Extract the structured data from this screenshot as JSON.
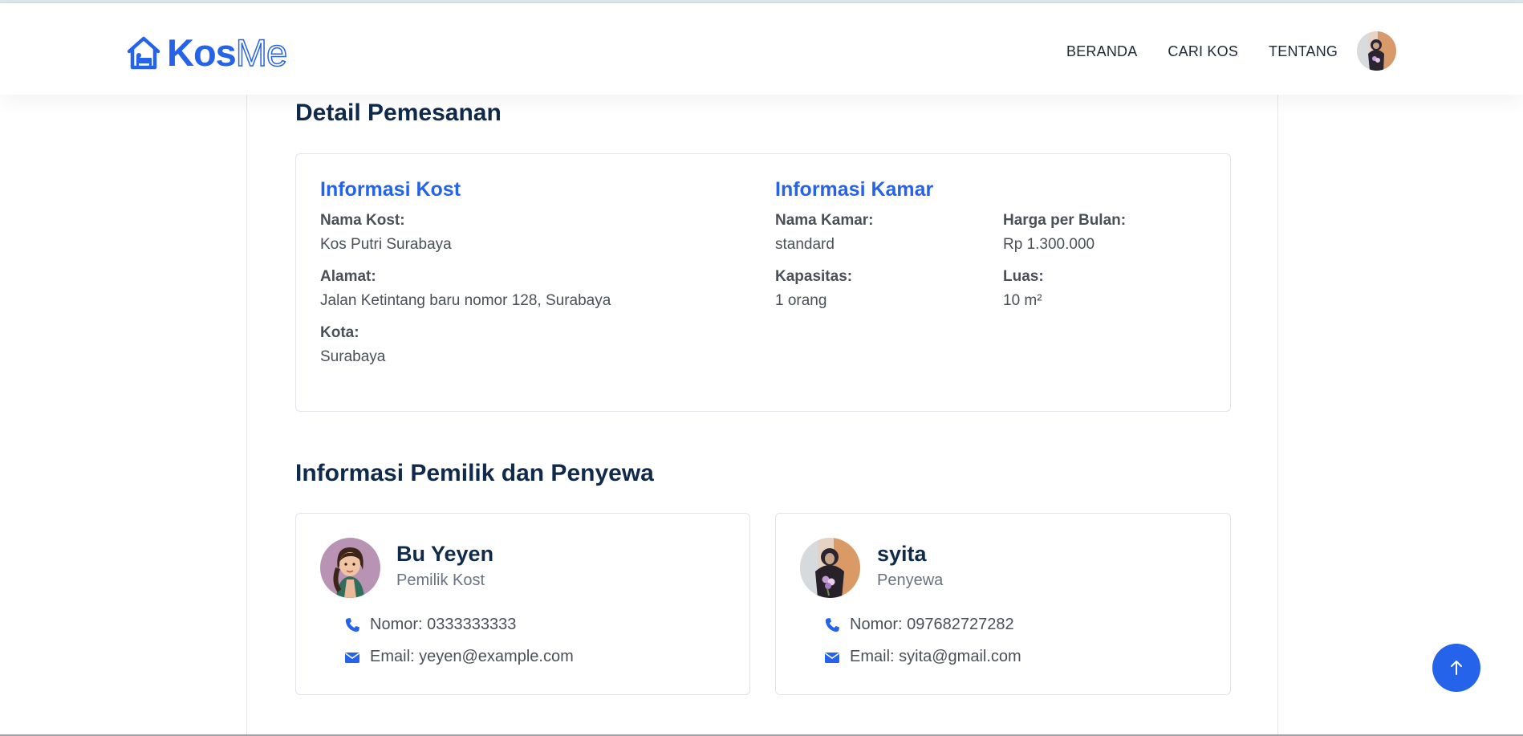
{
  "brand": {
    "part1": "Kos",
    "part2": "Me",
    "icon": "house-bed-icon",
    "color": "#2563eb"
  },
  "nav": {
    "links": [
      "BERANDA",
      "CARI KOS",
      "TENTANG"
    ],
    "avatar": "user-avatar"
  },
  "booking": {
    "title": "Detail Pemesanan",
    "kost": {
      "heading": "Informasi Kost",
      "name_label": "Nama Kost:",
      "name": "Kos Putri Surabaya",
      "address_label": "Alamat:",
      "address": "Jalan Ketintang baru nomor 128, Surabaya",
      "city_label": "Kota:",
      "city": "Surabaya"
    },
    "room": {
      "heading": "Informasi Kamar",
      "name_label": "Nama Kamar:",
      "name": "standard",
      "price_label": "Harga per Bulan:",
      "price": "Rp 1.300.000",
      "capacity_label": "Kapasitas:",
      "capacity": "1 orang",
      "area_label": "Luas:",
      "area": "10 m²"
    }
  },
  "people": {
    "title": "Informasi Pemilik dan Penyewa",
    "owner": {
      "name": "Bu Yeyen",
      "role": "Pemilik Kost",
      "phone": "Nomor: 0333333333",
      "email": "Email: yeyen@example.com"
    },
    "tenant": {
      "name": "syita",
      "role": "Penyewa",
      "phone": "Nomor: 097682727282",
      "email": "Email: syita@gmail.com"
    }
  },
  "icons": {
    "phone": "phone-icon",
    "email": "envelope-icon",
    "scroll_top": "arrow-up-icon"
  },
  "colors": {
    "accent": "#2563eb",
    "heading": "#0f2a4a"
  }
}
